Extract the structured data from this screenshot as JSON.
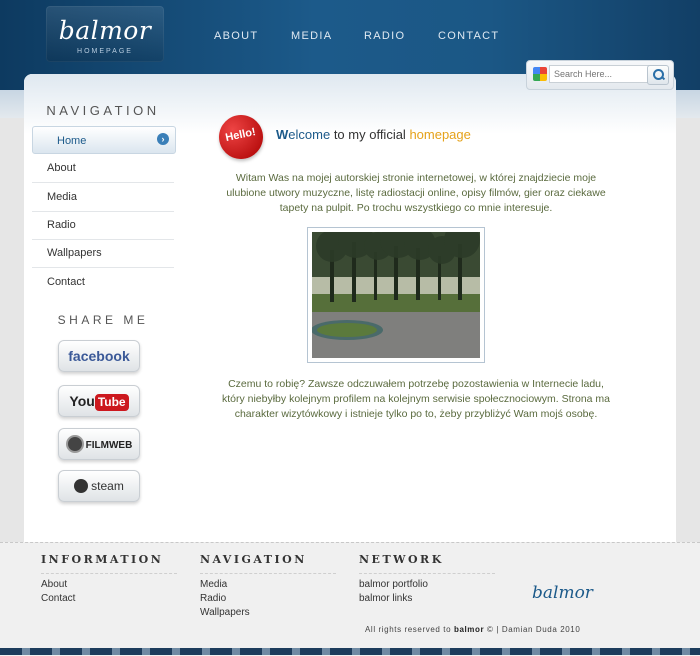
{
  "site": {
    "logo": "balmor",
    "logo_sub": "HOMEPAGE"
  },
  "topnav": [
    "ABOUT",
    "MEDIA",
    "RADIO",
    "CONTACT"
  ],
  "search": {
    "placeholder": "Search Here..."
  },
  "sidebar": {
    "heading": "NAVIGATION",
    "items": [
      {
        "label": "Home",
        "active": true
      },
      {
        "label": "About",
        "active": false
      },
      {
        "label": "Media",
        "active": false
      },
      {
        "label": "Radio",
        "active": false
      },
      {
        "label": "Wallpapers",
        "active": false
      },
      {
        "label": "Contact",
        "active": false
      }
    ],
    "share_heading": "SHARE ME",
    "share": {
      "facebook": "facebook",
      "youtube_you": "You",
      "youtube_tube": "Tube",
      "filmweb": "FILMWEB",
      "steam": "steam"
    }
  },
  "content": {
    "badge": "Hello!",
    "welcome_first": "W",
    "welcome_rest": "elcome",
    "welcome_mid": " to my official ",
    "welcome_hp": "homepage",
    "para1": "Witam Was na mojej autorskiej stronie internetowej, w której znajdziecie moje ulubione utwory muzyczne, listę radiostacji online, opisy filmów, gier oraz ciekawe tapety na pulpit. Po trochu wszystkiego co mnie interesuje.",
    "para2": "Czemu to robię? Zawsze odczuwałem potrzebę pozostawienia w Internecie ladu, który niebyłby kolejnym profilem na kolejnym serwisie społecznociowym. Strona ma charakter wizytówkowy i istnieje tylko po to, żeby przybliżyć Wam mojś osobę."
  },
  "footer": {
    "information": {
      "heading": "INFORMATION",
      "links": [
        "About",
        "Contact"
      ]
    },
    "navigation": {
      "heading": "NAVIGATION",
      "links": [
        "Media",
        "Radio",
        "Wallpapers"
      ]
    },
    "network": {
      "heading": "NETWORK",
      "links": [
        "balmor portfolio",
        "balmor links"
      ]
    },
    "logo": "balmor",
    "copyright_pre": "All rights reserved to ",
    "copyright_name": "balmor",
    "copyright_post": " © | Damian Duda 2010"
  }
}
